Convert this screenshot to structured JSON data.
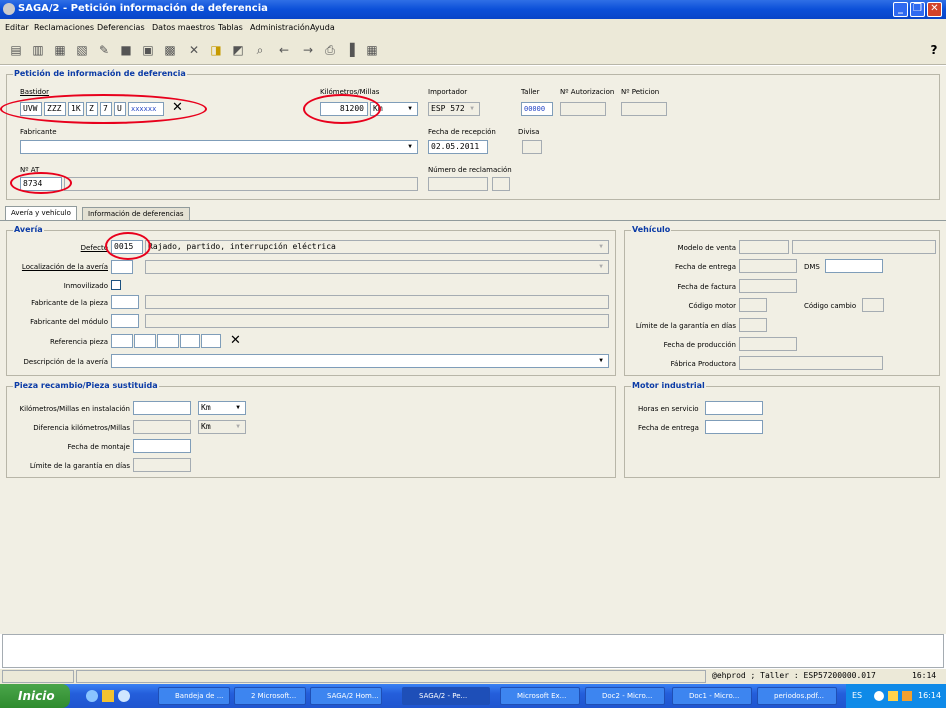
{
  "window": {
    "title": "SAGA/2 - Petición información de deferencia",
    "help": "?"
  },
  "menu": [
    "Editar",
    "Reclamaciones",
    "Deferencias",
    "Datos maestros",
    "Tablas",
    "Administración",
    "Ayuda"
  ],
  "header": {
    "group_title": "Petición de información de deferencia",
    "bastidor": {
      "label": "Bastidor",
      "segments": [
        "UVW",
        "ZZZ",
        "1K",
        "Z",
        "7",
        "U",
        "xxxxxx"
      ]
    },
    "km": {
      "label": "Kilómetros/Millas",
      "value": "81200",
      "unit": "Km"
    },
    "importador": {
      "label": "Importador",
      "value": "ESP 572"
    },
    "taller": {
      "label": "Taller",
      "value": "00000"
    },
    "n_autorizacion": {
      "label": "Nº Autorizacion",
      "value": ""
    },
    "n_peticion": {
      "label": "Nº Peticion",
      "value": ""
    },
    "fabricante": {
      "label": "Fabricante",
      "value": ""
    },
    "fecha_recepcion": {
      "label": "Fecha de recepción",
      "value": "02.05.2011"
    },
    "divisa": {
      "label": "Divisa",
      "value": ""
    },
    "n_at": {
      "label": "Nº AT",
      "value": "8734"
    },
    "num_reclamacion": {
      "label": "Número de reclamación",
      "value": ""
    }
  },
  "tabs": [
    "Avería y vehículo",
    "Información de deferencias"
  ],
  "averia": {
    "title": "Avería",
    "defecto": {
      "label": "Defecto",
      "code": "0015",
      "desc": "Rajado, partido, interrupción eléctrica"
    },
    "localizacion": {
      "label": "Localización de la avería"
    },
    "inmovilizado": {
      "label": "Inmovilizado"
    },
    "fab_pieza": {
      "label": "Fabricante de la pieza"
    },
    "fab_modulo": {
      "label": "Fabricante del módulo"
    },
    "ref_pieza": {
      "label": "Referencia pieza"
    },
    "descripcion": {
      "label": "Descripción de la avería"
    }
  },
  "vehiculo": {
    "title": "Vehículo",
    "modelo": "Modelo de venta",
    "fecha_entrega": "Fecha de entrega",
    "dms": "DMS",
    "fecha_factura": "Fecha de factura",
    "codigo_motor": "Código motor",
    "codigo_cambio": "Código cambio",
    "limite_garantia": "Límite de la garantía en días",
    "fecha_produccion": "Fecha de producción",
    "fabrica": "Fábrica Productora"
  },
  "pieza": {
    "title": "Pieza recambio/Pieza sustituida",
    "km_instalacion": "Kilómetros/Millas en instalación",
    "km_unit1": "Km",
    "diferencia": "Diferencia kilómetros/Millas",
    "km_unit2": "Km",
    "fecha_montaje": "Fecha de montaje",
    "limite_garantia": "Límite de la garantía en días"
  },
  "motor": {
    "title": "Motor industrial",
    "horas": "Horas en servicio",
    "fecha_entrega": "Fecha de entrega"
  },
  "status": {
    "text": "@ehprod ; Taller : ESP57200000.017",
    "time": "16:14"
  },
  "taskbar": {
    "start": "Inicio",
    "items": [
      "Bandeja de ...",
      "2 Microsoft...",
      "SAGA/2 Hom...",
      "SAGA/2 - Pe...",
      "Microsoft Ex...",
      "Doc2 - Micro...",
      "Doc1 - Micro...",
      "periodos.pdf..."
    ],
    "lang": "ES",
    "clock": "16:14"
  }
}
